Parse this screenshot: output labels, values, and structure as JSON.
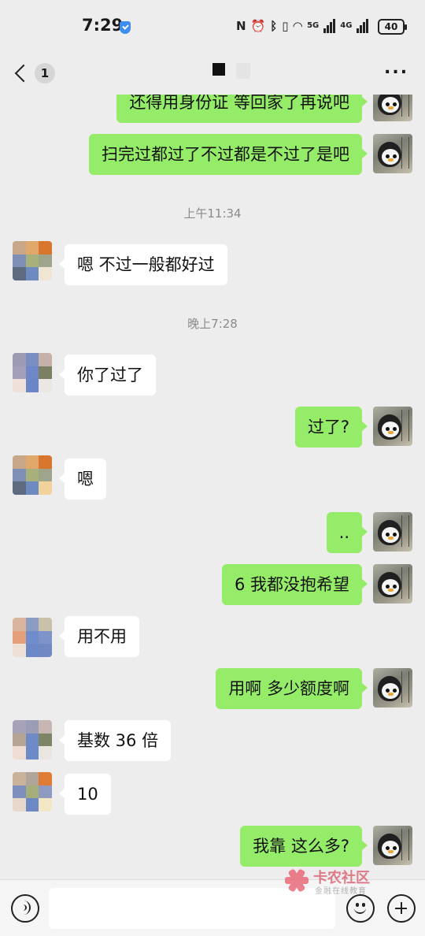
{
  "status_bar": {
    "time": "7:29",
    "network_5g": "5G",
    "network_4g": "4G",
    "battery": "40"
  },
  "header": {
    "unread_count": "1"
  },
  "messages": [
    {
      "side": "out",
      "text": "还得用身份证 等回家了再说吧"
    },
    {
      "side": "out",
      "text": "扫完过都过了不过都是不过了是吧"
    },
    {
      "side": "in",
      "text": "嗯 不过一般都好过"
    },
    {
      "side": "in",
      "text": "你了过了"
    },
    {
      "side": "out",
      "text": "过了?"
    },
    {
      "side": "in",
      "text": "嗯"
    },
    {
      "side": "out",
      "text": ".."
    },
    {
      "side": "out",
      "text": "6 我都没抱希望"
    },
    {
      "side": "in",
      "text": "用不用"
    },
    {
      "side": "out",
      "text": "用啊 多少额度啊"
    },
    {
      "side": "in",
      "text": "基数 36 倍"
    },
    {
      "side": "in",
      "text": "10"
    },
    {
      "side": "out",
      "text": "我靠 这么多?"
    }
  ],
  "timestamps": [
    "上午11:34",
    "晚上7:28"
  ],
  "watermark": {
    "title": "卡农社区",
    "subtitle": "金融在线教育"
  },
  "input": {
    "value": ""
  },
  "colors": {
    "background": "#ededed",
    "outgoing_bubble": "#95ec69",
    "incoming_bubble": "#ffffff"
  },
  "icons": [
    "back-chevron-icon",
    "more-icon",
    "voice-icon",
    "emoji-icon",
    "plus-icon",
    "verified-shield-icon",
    "nfc-icon",
    "alarm-icon",
    "bluetooth-icon",
    "vibrate-icon",
    "wifi-icon",
    "signal-icon",
    "battery-icon"
  ]
}
